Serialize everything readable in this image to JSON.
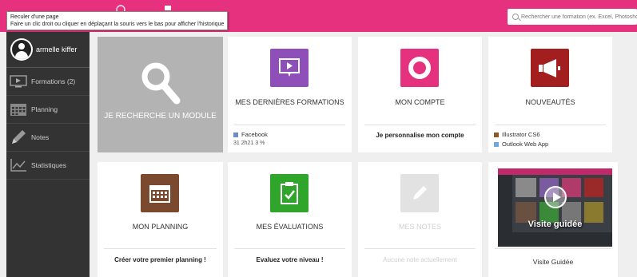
{
  "tooltip": {
    "line1": "Reculer d'une page",
    "line2": "Faire un clic droit ou cliquer en déplaçant la souris vers le bas pour afficher l'historique"
  },
  "search": {
    "placeholder": "Rechercher une formation (ex. Excel, Photoshop)"
  },
  "colors": {
    "brand": "#e6317f",
    "sidebar": "#333333"
  },
  "sidebar": {
    "user": "armelle kiffer",
    "items": [
      {
        "label": "Formations (2)",
        "icon": "video-icon"
      },
      {
        "label": "Planning",
        "icon": "calendar-icon"
      },
      {
        "label": "Notes",
        "icon": "pencil-icon"
      },
      {
        "label": "Statistiques",
        "icon": "chart-icon"
      }
    ]
  },
  "tiles": {
    "search": {
      "label": "JE RECHERCHE UN MODULE"
    },
    "last_courses": {
      "title": "MES DERNIÈRES FORMATIONS",
      "course": "Facebook",
      "stats": "31  2h21  3 %"
    },
    "account": {
      "title": "MON COMPTE",
      "subtitle": "Je personnalise mon compte"
    },
    "news": {
      "title": "NOUVEAUTÉS",
      "items": [
        "Illustrator CS6",
        "Outlook Web App"
      ]
    },
    "planning": {
      "title": "MON PLANNING",
      "subtitle": "Créer votre premier planning !"
    },
    "evaluations": {
      "title": "MES ÉVALUATIONS",
      "subtitle": "Evaluez votre niveau !"
    },
    "notes": {
      "title": "MES NOTES",
      "subtitle": "Aucune note actuellement"
    },
    "tour": {
      "overlay": "Visite guidée",
      "label": "Visite Guidée"
    }
  }
}
